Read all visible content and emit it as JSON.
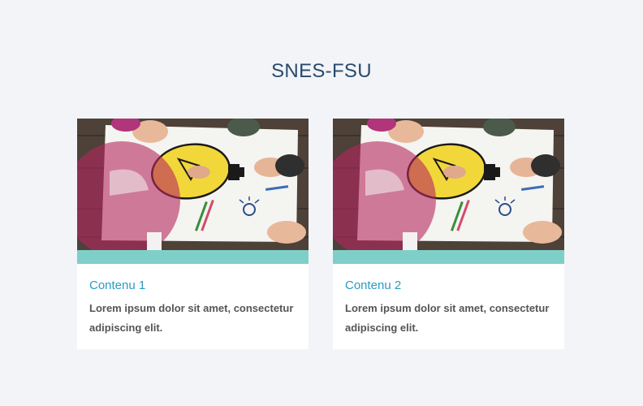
{
  "section": {
    "title": "SNES-FSU"
  },
  "cards": [
    {
      "title": "Contenu 1",
      "text": "Lorem ipsum dolor sit amet, consectetur adipiscing elit."
    },
    {
      "title": "Contenu 2",
      "text": "Lorem ipsum dolor sit amet, consectetur adipiscing elit."
    }
  ],
  "colors": {
    "band": "#7fcfc9",
    "title_link": "#2a9bc4",
    "heading": "#2b4a6b"
  }
}
